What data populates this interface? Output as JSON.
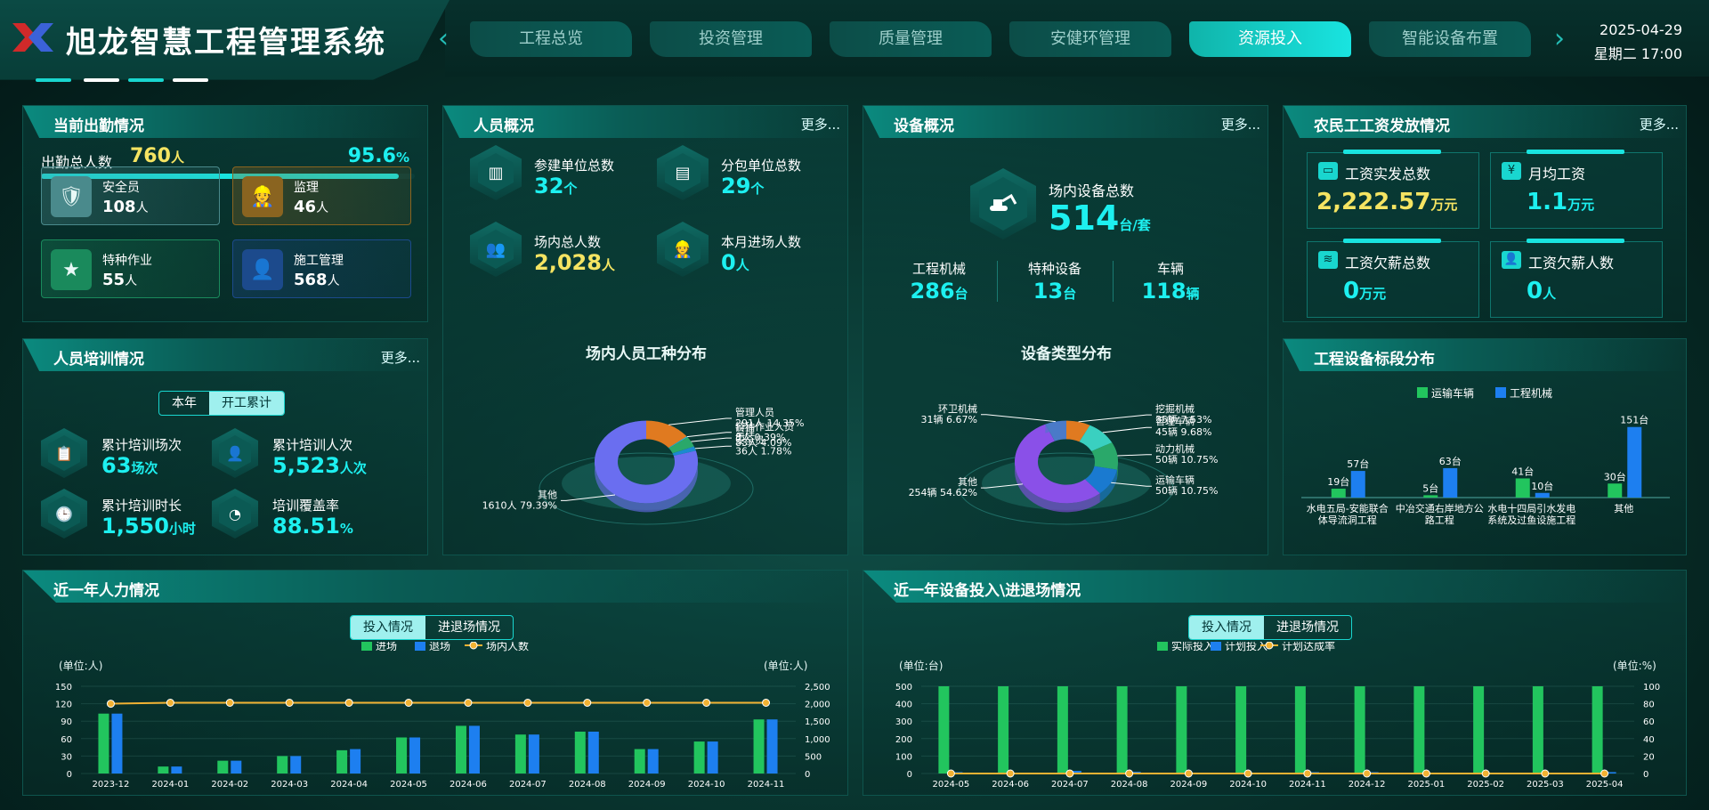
{
  "header": {
    "title": "旭龙智慧工程管理系统",
    "date": "2025-04-29",
    "weekday_time": "星期二 17:00",
    "tabs": [
      "工程总览",
      "投资管理",
      "质量管理",
      "安健环管理",
      "资源投入",
      "智能设备布置"
    ],
    "active_tab": 4
  },
  "attendance": {
    "title": "当前出勤情况",
    "total_label": "出勤总人数",
    "total_value": "760",
    "total_unit": "人",
    "rate": "95.6",
    "rate_unit": "%",
    "rate_fraction": 0.956,
    "cards": [
      {
        "label": "安全员",
        "value": "108",
        "unit": "人",
        "color": "#4a8a8c"
      },
      {
        "label": "监理",
        "value": "46",
        "unit": "人",
        "color": "#8a6420"
      },
      {
        "label": "特种作业",
        "value": "55",
        "unit": "人",
        "color": "#1a8a5c"
      },
      {
        "label": "施工管理",
        "value": "568",
        "unit": "人",
        "color": "#1c4a8c"
      }
    ]
  },
  "training": {
    "title": "人员培训情况",
    "more": "更多...",
    "seg": [
      "本年",
      "开工累计"
    ],
    "items": [
      {
        "label": "累计培训场次",
        "value": "63",
        "unit": "场次"
      },
      {
        "label": "累计培训人次",
        "value": "5,523",
        "unit": "人次"
      },
      {
        "label": "累计培训时长",
        "value": "1,550",
        "unit": "小时"
      },
      {
        "label": "培训覆盖率",
        "value": "88.51",
        "unit": "%"
      }
    ]
  },
  "personnel": {
    "title": "人员概况",
    "more": "更多...",
    "items": [
      {
        "label": "参建单位总数",
        "value": "32",
        "unit": "个"
      },
      {
        "label": "分包单位总数",
        "value": "29",
        "unit": "个"
      },
      {
        "label": "场内总人数",
        "value": "2,028",
        "unit": "人"
      },
      {
        "label": "本月进场人数",
        "value": "0",
        "unit": "人"
      }
    ],
    "chart_title": "场内人员工种分布",
    "pie": [
      {
        "label": "管理人员",
        "text": "291人 14.35%",
        "value": 14.35,
        "color": "#e07a20"
      },
      {
        "label": "特种作业人员",
        "text": "8人 0.39%",
        "value": 0.39,
        "color": "#2ab0e0"
      },
      {
        "label": "监理",
        "text": "83人 4.09%",
        "value": 4.09,
        "color": "#2aa86a"
      },
      {
        "label": "安全员",
        "text": "36人 1.78%",
        "value": 1.78,
        "color": "#1a8ad0"
      },
      {
        "label": "其他",
        "text": "1610人 79.39%",
        "value": 79.39,
        "color": "#6a6ef0"
      }
    ]
  },
  "equipment": {
    "title": "设备概况",
    "more": "更多...",
    "total_label": "场内设备总数",
    "total_value": "514",
    "total_unit": "台/套",
    "sub": [
      {
        "label": "工程机械",
        "value": "286",
        "unit": "台"
      },
      {
        "label": "特种设备",
        "value": "13",
        "unit": "台"
      },
      {
        "label": "车辆",
        "value": "118",
        "unit": "辆"
      }
    ],
    "chart_title": "设备类型分布",
    "pie": [
      {
        "label": "挖掘机械",
        "text": "35辆 7.53%",
        "value": 7.53,
        "color": "#e07a20"
      },
      {
        "label": "管理车辆",
        "text": "45辆 9.68%",
        "value": 9.68,
        "color": "#3ad0c0"
      },
      {
        "label": "动力机械",
        "text": "50辆 10.75%",
        "value": 10.75,
        "color": "#2aa86a"
      },
      {
        "label": "运输车辆",
        "text": "50辆 10.75%",
        "value": 10.75,
        "color": "#1a7ad0"
      },
      {
        "label": "其他",
        "text": "254辆 54.62%",
        "value": 54.62,
        "color": "#8a50e8"
      },
      {
        "label": "环卫机械",
        "text": "31辆 6.67%",
        "value": 6.67,
        "color": "#4a7ac8"
      }
    ]
  },
  "wages": {
    "title": "农民工工资发放情况",
    "more": "更多...",
    "items": [
      {
        "label": "工资实发总数",
        "value": "2,222.57",
        "unit": "万元",
        "style": "yel"
      },
      {
        "label": "月均工资",
        "value": "1.1",
        "unit": "万元",
        "style": "cyan"
      },
      {
        "label": "工资欠薪总数",
        "value": "0",
        "unit": "万元",
        "style": "cyan"
      },
      {
        "label": "工资欠薪人数",
        "value": "0",
        "unit": "人",
        "style": "cyan"
      }
    ]
  },
  "section_chart": {
    "title": "工程设备标段分布"
  },
  "manpower": {
    "title": "近一年人力情况",
    "seg": [
      "投入情况",
      "进退场情况"
    ],
    "left_unit": "(单位:人)",
    "right_unit": "(单位:人)"
  },
  "equip_year": {
    "title": "近一年设备投入\\进退场情况",
    "seg": [
      "投入情况",
      "进退场情况"
    ],
    "left_unit": "(单位:台)",
    "right_unit": "(单位:%)"
  },
  "chart_data": [
    {
      "type": "bar",
      "id": "section",
      "legend": [
        "运输车辆",
        "工程机械"
      ],
      "categories": [
        "水电五局-安能联合体导流洞工程",
        "中冶交通右岸地方公路工程",
        "水电十四局引水发电系统及过鱼设施工程",
        "其他"
      ],
      "series": [
        {
          "name": "运输车辆",
          "values": [
            19,
            5,
            41,
            30
          ],
          "color": "#22c55e"
        },
        {
          "name": "工程机械",
          "values": [
            57,
            63,
            10,
            151
          ],
          "color": "#1d7ff0"
        }
      ],
      "value_suffix": "台"
    },
    {
      "type": "bar",
      "id": "manpower",
      "legend": [
        "进场",
        "退场",
        "场内人数"
      ],
      "categories": [
        "2023-12",
        "2024-01",
        "2024-02",
        "2024-03",
        "2024-04",
        "2024-05",
        "2024-06",
        "2024-07",
        "2024-08",
        "2024-09",
        "2024-10",
        "2024-11"
      ],
      "series": [
        {
          "name": "进场",
          "values": [
            103,
            12,
            22,
            30,
            40,
            62,
            82,
            67,
            72,
            42,
            55,
            93
          ],
          "color": "#22c55e"
        },
        {
          "name": "退场",
          "values": [
            103,
            12,
            22,
            30,
            42,
            62,
            82,
            67,
            72,
            42,
            55,
            93
          ],
          "color": "#1d7ff0"
        },
        {
          "name": "场内人数",
          "axis": "right",
          "values": [
            2000,
            2028,
            2028,
            2028,
            2028,
            2028,
            2028,
            2028,
            2028,
            2028,
            2028,
            2028
          ],
          "color": "#f2b233"
        }
      ],
      "ylim": [
        0,
        150
      ],
      "yticks": [
        0,
        30,
        60,
        90,
        120,
        150
      ],
      "y2lim": [
        0,
        2500
      ],
      "y2ticks": [
        "0",
        "500",
        "1,000",
        "1,500",
        "2,000",
        "2,500"
      ]
    },
    {
      "type": "bar",
      "id": "equipyear",
      "legend": [
        "实际投入",
        "计划投入",
        "计划达成率"
      ],
      "categories": [
        "2024-05",
        "2024-06",
        "2024-07",
        "2024-08",
        "2024-09",
        "2024-10",
        "2024-11",
        "2024-12",
        "2025-01",
        "2025-02",
        "2025-03",
        "2025-04"
      ],
      "series": [
        {
          "name": "实际投入",
          "values": [
            500,
            500,
            500,
            500,
            500,
            500,
            500,
            500,
            500,
            500,
            500,
            500
          ],
          "color": "#22c55e"
        },
        {
          "name": "计划投入",
          "values": [
            8,
            5,
            15,
            10,
            5,
            5,
            8,
            8,
            5,
            5,
            5,
            8
          ],
          "color": "#1d7ff0"
        },
        {
          "name": "计划达成率",
          "axis": "right",
          "values": [
            0,
            0,
            0,
            0,
            0,
            0,
            0,
            0,
            0,
            0,
            0,
            0
          ],
          "color": "#f2b233"
        }
      ],
      "ylim": [
        0,
        500
      ],
      "yticks": [
        0,
        100,
        200,
        300,
        400,
        500
      ],
      "y2lim": [
        0,
        100
      ],
      "y2ticks": [
        "0",
        "20",
        "40",
        "60",
        "80",
        "100"
      ]
    }
  ]
}
